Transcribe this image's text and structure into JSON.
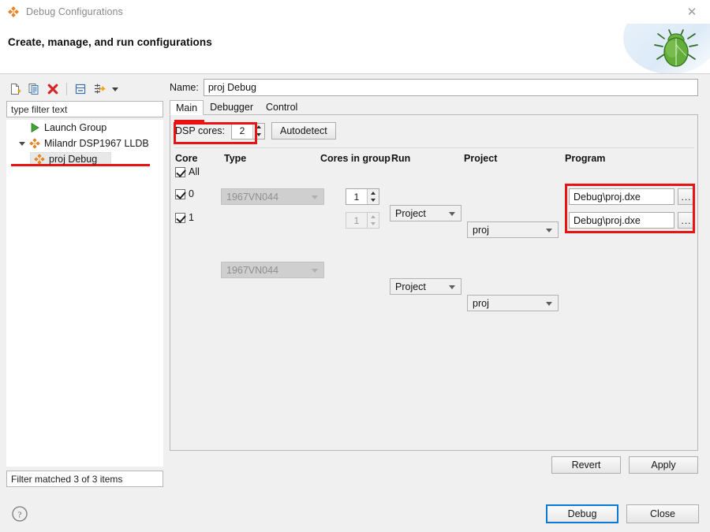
{
  "window": {
    "title": "Debug Configurations",
    "title_icon": "eclipse-launch-icon",
    "close_icon": "close-icon"
  },
  "banner": {
    "heading": "Create, manage, and run configurations",
    "art_icon": "green-bug-icon"
  },
  "left_panel": {
    "toolbar": [
      {
        "name": "new-configuration-icon",
        "tooltip": "New launch configuration"
      },
      {
        "name": "duplicate-configuration-icon",
        "tooltip": "Duplicate"
      },
      {
        "name": "delete-configuration-icon",
        "tooltip": "Delete"
      },
      {
        "name": "collapse-all-icon",
        "tooltip": "Collapse All"
      },
      {
        "name": "filter-icon",
        "tooltip": "Filter launch configurations"
      },
      {
        "name": "chevron-down-icon",
        "tooltip": "More"
      }
    ],
    "filter": {
      "placeholder": "type filter text",
      "value": ""
    },
    "tree": [
      {
        "label": "Launch Group",
        "icon": "green-play-icon",
        "level": 1,
        "expandable": false,
        "selected": false
      },
      {
        "label": "Milandr DSP1967 LLDB",
        "icon": "orange-diamond-icon",
        "level": 1,
        "expandable": true,
        "expanded": true,
        "selected": false
      },
      {
        "label": "proj Debug",
        "icon": "orange-diamond-icon",
        "level": 2,
        "expandable": false,
        "selected": true
      }
    ],
    "status": "Filter matched 3 of 3 items"
  },
  "right_panel": {
    "name_label": "Name:",
    "name_value": "proj Debug",
    "tabs": [
      {
        "label": "Main",
        "active": true
      },
      {
        "label": "Debugger",
        "active": false
      },
      {
        "label": "Control",
        "active": false
      }
    ],
    "dsp_cores": {
      "label": "DSP cores:",
      "value": "2"
    },
    "autodetect_label": "Autodetect",
    "table": {
      "headers": [
        "Core",
        "Type",
        "Cores in group",
        "Run",
        "Project",
        "Program"
      ],
      "all_label": "All",
      "all_checked": true,
      "rows": [
        {
          "core": "0",
          "core_checked": true,
          "type": "1967VN044",
          "type_disabled": true,
          "cores_in_group": "1",
          "cores_in_group_disabled": false,
          "run": "Project",
          "project": "proj",
          "program": "Debug\\proj.dxe",
          "browse_label": "..."
        },
        {
          "core": "1",
          "core_checked": true,
          "type": "1967VN044",
          "type_disabled": true,
          "cores_in_group": "1",
          "cores_in_group_disabled": true,
          "run": "Project",
          "project": "proj",
          "program": "Debug\\proj.dxe",
          "browse_label": "..."
        }
      ]
    },
    "revert_label": "Revert",
    "apply_label": "Apply"
  },
  "footer": {
    "help_icon": "help-icon",
    "debug_label": "Debug",
    "close_label": "Close"
  },
  "annotations": {
    "color": "#e81313",
    "items": [
      {
        "name": "annotation-proj-debug-underline",
        "kind": "line"
      },
      {
        "name": "annotation-main-tab-underline",
        "kind": "line"
      },
      {
        "name": "annotation-dsp-cores-box",
        "kind": "box"
      },
      {
        "name": "annotation-program-column-box",
        "kind": "box"
      }
    ]
  }
}
